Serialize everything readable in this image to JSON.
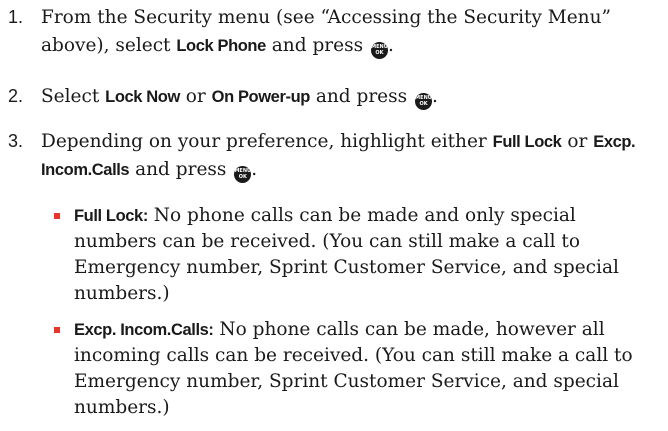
{
  "steps": [
    {
      "number": "1.",
      "text_a": "From the Security menu (see “Accessing the Security Menu” above), select ",
      "ui_a": "Lock Phone",
      "text_b": " and press ",
      "end": "."
    },
    {
      "number": "2.",
      "text_a": "Select ",
      "ui_a": "Lock Now",
      "text_b": " or ",
      "ui_b": "On Power-up",
      "text_c": " and press ",
      "end": "."
    },
    {
      "number": "3.",
      "text_a": "Depending on your preference, highlight either ",
      "ui_a": "Full Lock",
      "text_b": " or ",
      "ui_b": "Excp. Incom.Calls",
      "text_c": " and press ",
      "end": "."
    }
  ],
  "key_icon": {
    "name": "menu-ok-key-icon",
    "line1": "MENU",
    "line2": "OK"
  },
  "bullets": [
    {
      "term": "Full Lock:",
      "text": " No phone calls can be made and only special numbers can be received. (You can still make a call to Emergency number, Sprint Customer Service, and special numbers.)"
    },
    {
      "term": "Excp. Incom.Calls:",
      "text": " No phone calls can be made, however all incoming calls can be received. (You can still make a call to Emergency number, Sprint Customer Service, and special numbers.)"
    }
  ],
  "colors": {
    "text": "#1a1a1a",
    "bullet_accent": "#e8342a",
    "key_background": "#1a1a1a"
  }
}
